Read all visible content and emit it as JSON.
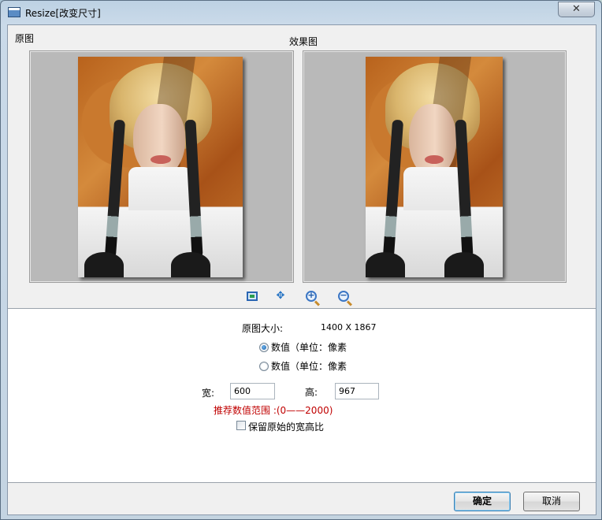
{
  "window": {
    "title": "Resize[改变尺寸]",
    "close_icon": "close-icon"
  },
  "panels": {
    "original_label": "原图",
    "result_label": "效果图"
  },
  "toolbar": {
    "icons": [
      "fit-window-icon",
      "actual-size-icon",
      "zoom-in-icon",
      "zoom-out-icon"
    ]
  },
  "settings": {
    "original_size_label": "原图大小:",
    "original_size_value": "1400 X 1867",
    "radio_options": [
      {
        "label": "数值（单位：像素",
        "checked": true
      },
      {
        "label": "数值（单位：像素",
        "checked": false
      }
    ],
    "width_label": "宽:",
    "width_value": "600",
    "height_label": "高:",
    "height_value": "967",
    "range_hint": "推荐数值范围 :(0——2000)",
    "keep_ratio_label": "保留原始的宽高比",
    "keep_ratio_checked": false
  },
  "buttons": {
    "ok": "确定",
    "cancel": "取消"
  },
  "colors": {
    "hint": "#c00000",
    "default_button_border": "#3c7fb1"
  }
}
